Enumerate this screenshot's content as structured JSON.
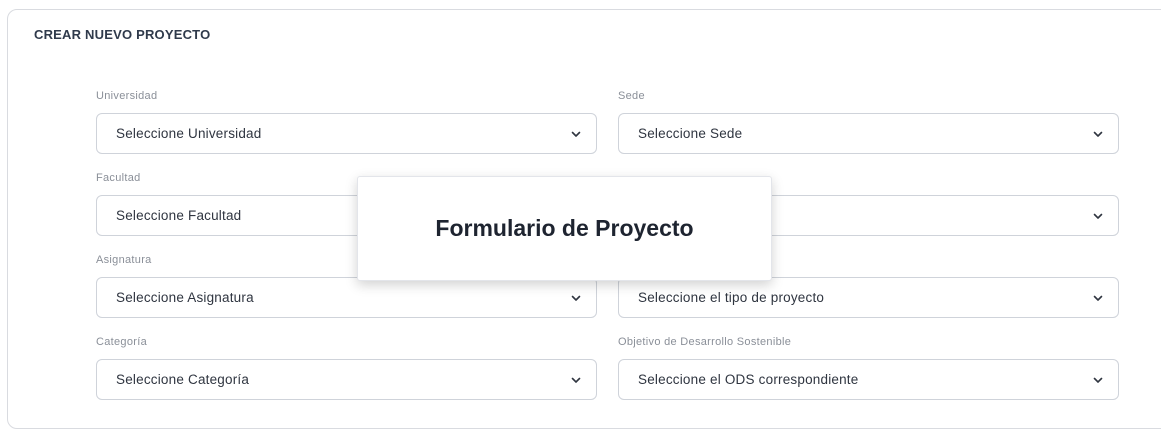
{
  "form": {
    "title": "CREAR NUEVO PROYECTO",
    "fields": {
      "universidad": {
        "label": "Universidad",
        "value": "Seleccione Universidad"
      },
      "sede": {
        "label": "Sede",
        "value": "Seleccione Sede"
      },
      "facultad": {
        "label": "Facultad",
        "value": "Seleccione Facultad"
      },
      "carrera": {
        "label": "",
        "value": ""
      },
      "asignatura": {
        "label": "Asignatura",
        "value": "Seleccione Asignatura"
      },
      "tipo": {
        "label": "",
        "value": "Seleccione el tipo de proyecto"
      },
      "categoria": {
        "label": "Categoría",
        "value": "Seleccione Categoría"
      },
      "ods": {
        "label": "Objetivo de Desarrollo Sostenible",
        "value": "Seleccione el ODS correspondiente"
      }
    }
  },
  "overlay": {
    "title": "Formulario de Proyecto"
  },
  "icons": {
    "dropdown": "chevron-down-icon"
  },
  "colors": {
    "border": "#cfd3da",
    "label": "#8a8f98",
    "text": "#2f3540"
  }
}
